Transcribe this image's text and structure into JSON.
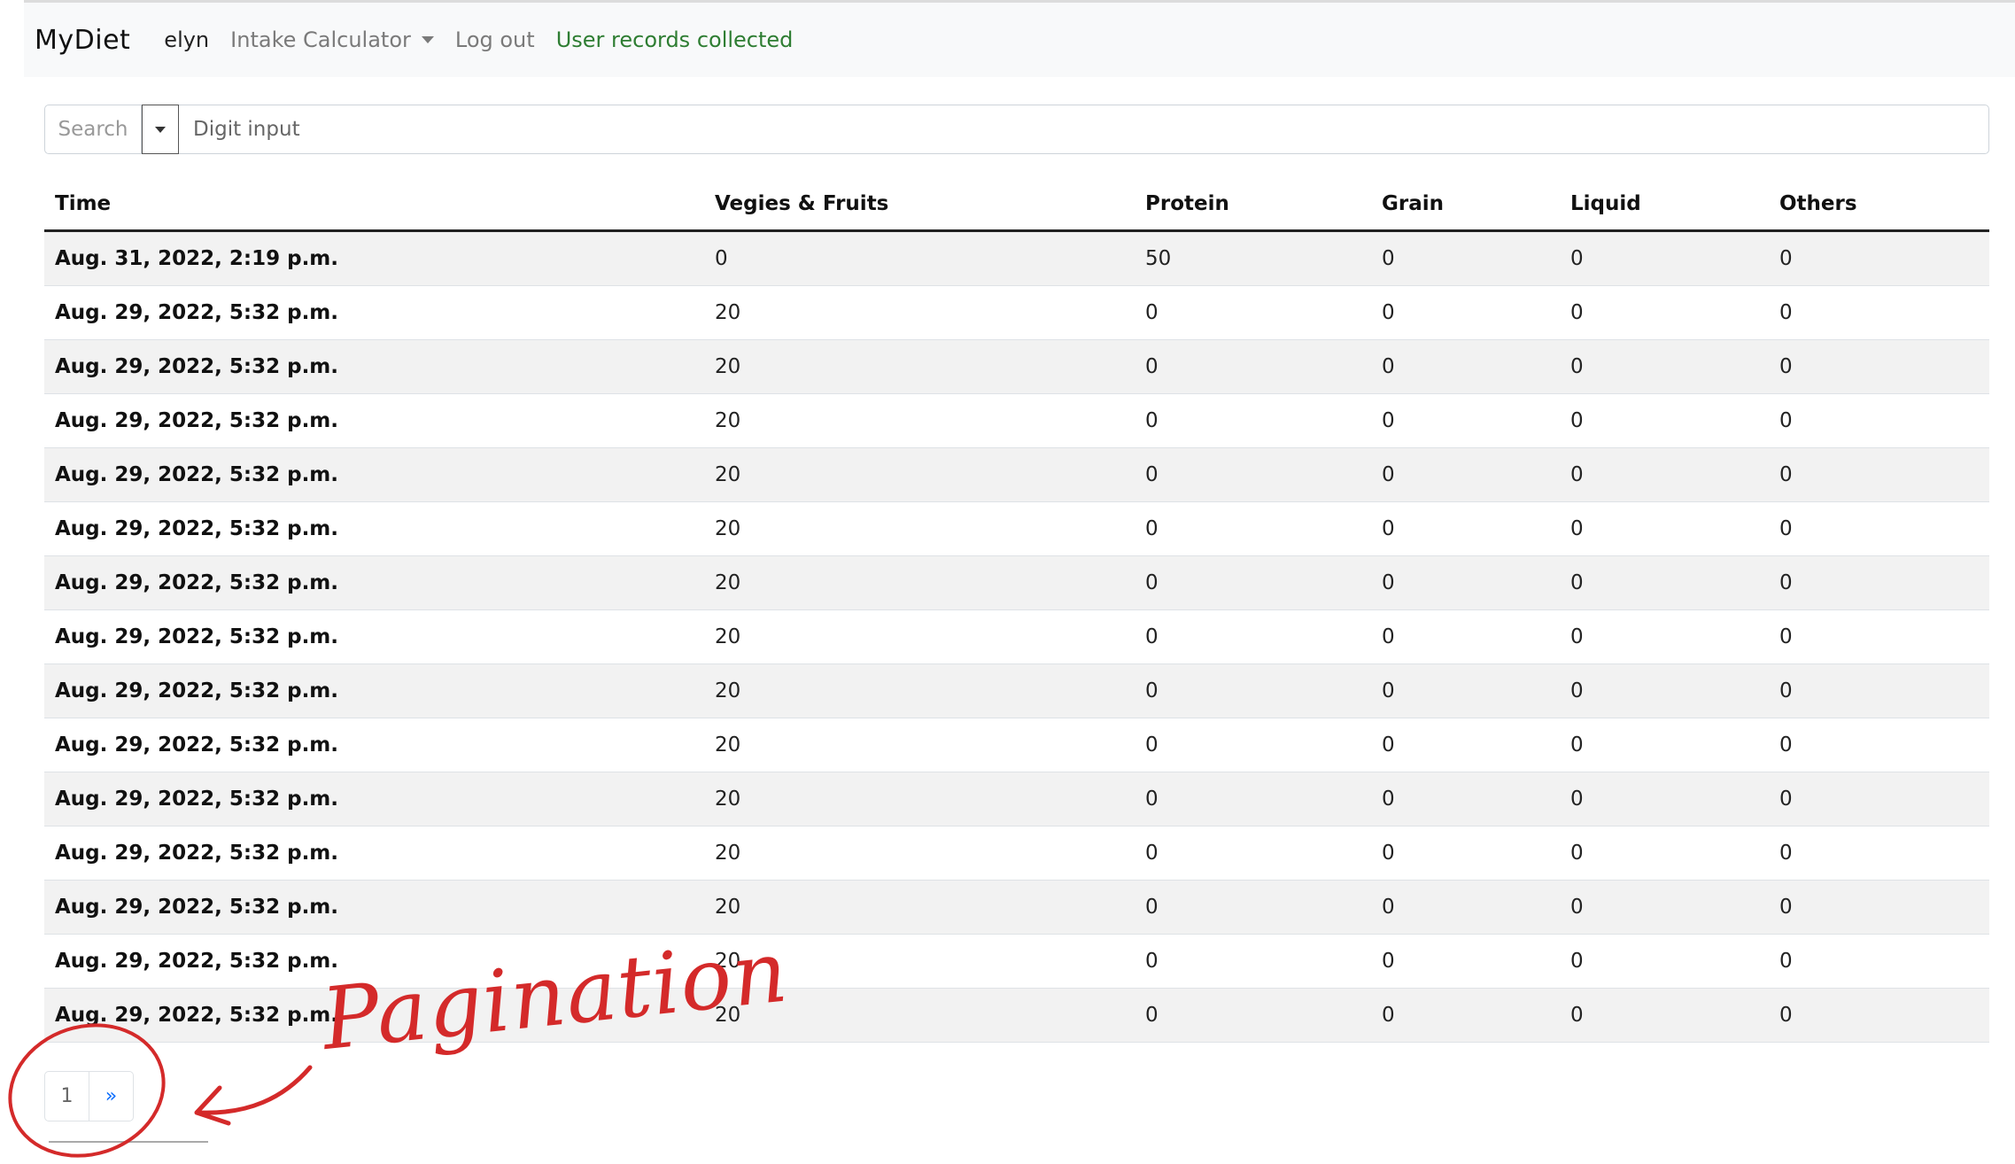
{
  "navbar": {
    "brand": "MyDiet",
    "user": "elyn",
    "intake_calculator": "Intake Calculator",
    "logout": "Log out",
    "status": "User records collected"
  },
  "search": {
    "button_label": "Search",
    "placeholder": "Digit input"
  },
  "table": {
    "headers": [
      "Time",
      "Vegies & Fruits",
      "Protein",
      "Grain",
      "Liquid",
      "Others"
    ],
    "rows": [
      [
        "Aug. 31, 2022, 2:19 p.m.",
        "0",
        "50",
        "0",
        "0",
        "0"
      ],
      [
        "Aug. 29, 2022, 5:32 p.m.",
        "20",
        "0",
        "0",
        "0",
        "0"
      ],
      [
        "Aug. 29, 2022, 5:32 p.m.",
        "20",
        "0",
        "0",
        "0",
        "0"
      ],
      [
        "Aug. 29, 2022, 5:32 p.m.",
        "20",
        "0",
        "0",
        "0",
        "0"
      ],
      [
        "Aug. 29, 2022, 5:32 p.m.",
        "20",
        "0",
        "0",
        "0",
        "0"
      ],
      [
        "Aug. 29, 2022, 5:32 p.m.",
        "20",
        "0",
        "0",
        "0",
        "0"
      ],
      [
        "Aug. 29, 2022, 5:32 p.m.",
        "20",
        "0",
        "0",
        "0",
        "0"
      ],
      [
        "Aug. 29, 2022, 5:32 p.m.",
        "20",
        "0",
        "0",
        "0",
        "0"
      ],
      [
        "Aug. 29, 2022, 5:32 p.m.",
        "20",
        "0",
        "0",
        "0",
        "0"
      ],
      [
        "Aug. 29, 2022, 5:32 p.m.",
        "20",
        "0",
        "0",
        "0",
        "0"
      ],
      [
        "Aug. 29, 2022, 5:32 p.m.",
        "20",
        "0",
        "0",
        "0",
        "0"
      ],
      [
        "Aug. 29, 2022, 5:32 p.m.",
        "20",
        "0",
        "0",
        "0",
        "0"
      ],
      [
        "Aug. 29, 2022, 5:32 p.m.",
        "20",
        "0",
        "0",
        "0",
        "0"
      ],
      [
        "Aug. 29, 2022, 5:32 p.m.",
        "20",
        "0",
        "0",
        "0",
        "0"
      ],
      [
        "Aug. 29, 2022, 5:32 p.m.",
        "20",
        "0",
        "0",
        "0",
        "0"
      ]
    ]
  },
  "pagination": {
    "current": "1",
    "next": "»"
  },
  "annotation": {
    "text": "Pagination",
    "color": "#d42a2a"
  },
  "colors": {
    "navbar_bg": "#f8f9fa",
    "status_green": "#2e7d32",
    "link_blue": "#0d6efd",
    "row_stripe": "#f2f2f2"
  }
}
